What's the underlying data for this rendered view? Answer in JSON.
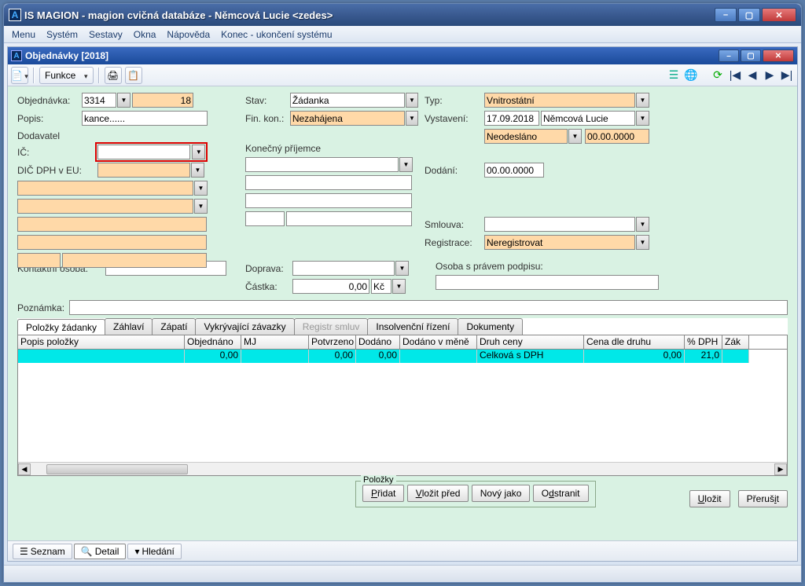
{
  "app_title": "IS MAGION - magion cvičná databáze - Němcová Lucie <zedes>",
  "menu": [
    "Menu",
    "Systém",
    "Sestavy",
    "Okna",
    "Nápověda",
    "Konec - ukončení systému"
  ],
  "inner_title": "Objednávky [2018]",
  "toolbar": {
    "funkce": "Funkce"
  },
  "labels": {
    "objednavka": "Objednávka:",
    "popis": "Popis:",
    "dodavatel": "Dodavatel",
    "ico": "IČ:",
    "diceu": "DIČ DPH v EU:",
    "kontaktni": "Kontaktní osoba:",
    "stav": "Stav:",
    "finkon": "Fin. kon.:",
    "konecny": "Konečný příjemce",
    "doprava": "Doprava:",
    "castka": "Částka:",
    "typ": "Typ:",
    "vystaveni": "Vystavení:",
    "dodani": "Dodání:",
    "smlouva": "Smlouva:",
    "registrace": "Registrace:",
    "osoba_podpis": "Osoba s právem podpisu:",
    "poznamka": "Poznámka:"
  },
  "values": {
    "obj_num": "3314",
    "obj_sub": "18",
    "popis": "kance......",
    "stav": "Žádanka",
    "finkon": "Nezahájena",
    "typ": "Vnitrostátní",
    "vyst_dat": "17.09.2018",
    "vyst_jmeno": "Němcová Lucie",
    "odesl": "Neodesláno",
    "odesl_dat": "00.00.0000",
    "dodani": "00.00.0000",
    "registrace": "Neregistrovat",
    "castka": "0,00",
    "mena": "Kč"
  },
  "tabs": [
    "Položky žádanky",
    "Záhlaví",
    "Zápatí",
    "Vykrývající závazky",
    "Registr smluv",
    "Insolvenční řízení",
    "Dokumenty"
  ],
  "grid_headers": [
    "Popis položky",
    "Objednáno",
    "MJ",
    "Potvrzeno",
    "Dodáno",
    "Dodáno v měně",
    "Druh ceny",
    "Cena dle druhu",
    "% DPH",
    "Zák"
  ],
  "grid_row": {
    "objednano": "0,00",
    "potvrzeno": "0,00",
    "dodano": "0,00",
    "druhceny": "Celková s DPH",
    "cena": "0,00",
    "dph": "21,0"
  },
  "btns": {
    "polozky": "Položky",
    "pridat": "Přidat",
    "vlozit": "Vložit před",
    "novy": "Nový jako",
    "odstranit": "Odstranit",
    "ulozit": "Uložit",
    "prerusit": "Přerušit"
  },
  "bottom_tabs": {
    "seznam": "Seznam",
    "detail": "Detail",
    "hledani": "Hledání"
  }
}
